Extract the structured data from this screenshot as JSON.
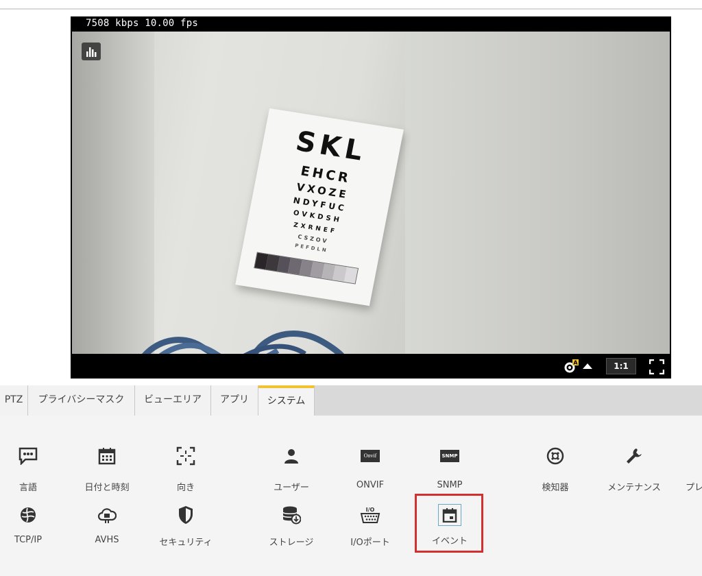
{
  "video": {
    "stats": "7508 kbps 10.00 fps",
    "ratio_label": "1:1",
    "eye_chart": {
      "rows": [
        "SKL",
        "EHCR",
        "VXOZE",
        "NDYFUC",
        "OVKDSH",
        "ZXRNEF",
        "CSZOV",
        "PEFDLN"
      ]
    }
  },
  "tabs": [
    {
      "label": "PTZ"
    },
    {
      "label": "プライバシーマスク"
    },
    {
      "label": "ビューエリア"
    },
    {
      "label": "アプリ"
    },
    {
      "label": "システム",
      "active": true
    }
  ],
  "system_items": [
    {
      "label": "言語",
      "icon": "chat-icon"
    },
    {
      "label": "日付と時刻",
      "icon": "calendar-icon"
    },
    {
      "label": "向き",
      "icon": "orientation-icon"
    },
    {
      "label": "ユーザー",
      "icon": "user-icon"
    },
    {
      "label": "ONVIF",
      "icon": "onvif-icon",
      "badge": "Onvif"
    },
    {
      "label": "SNMP",
      "icon": "snmp-icon",
      "badge": "SNMP"
    },
    {
      "label": "検知器",
      "icon": "detector-icon"
    },
    {
      "label": "メンテナンス",
      "icon": "wrench-icon"
    },
    {
      "label": "プレ",
      "icon": "plain-config-icon"
    },
    {
      "label": "TCP/IP",
      "icon": "network-icon"
    },
    {
      "label": "AVHS",
      "icon": "cloud-icon"
    },
    {
      "label": "セキュリティ",
      "icon": "shield-icon"
    },
    {
      "label": "ストレージ",
      "icon": "storage-icon"
    },
    {
      "label": "I/Oポート",
      "icon": "io-port-icon",
      "badge": "I/O"
    },
    {
      "label": "イベント",
      "icon": "event-icon",
      "highlighted": true
    }
  ],
  "colors": {
    "active_tab_accent": "#f2c230",
    "highlight_border": "#d32f2f"
  }
}
